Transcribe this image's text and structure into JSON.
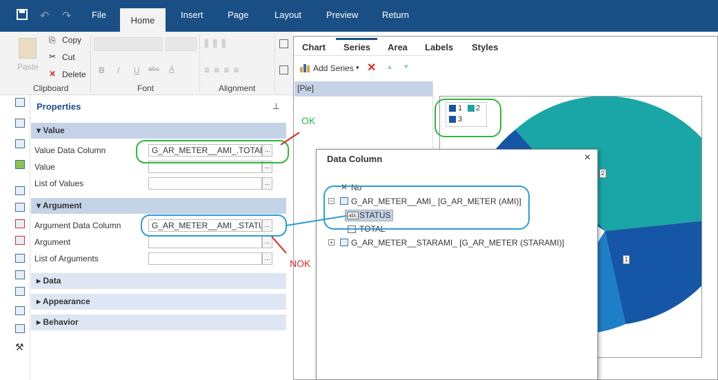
{
  "menu": {
    "file": "File",
    "home": "Home",
    "insert": "Insert",
    "page": "Page",
    "layout": "Layout",
    "preview": "Preview",
    "return": "Return"
  },
  "ribbon": {
    "paste": "Paste",
    "copy": "Copy",
    "cut": "Cut",
    "delete": "Delete",
    "clipboard": "Clipboard",
    "font": "Font",
    "alignment": "Alignment",
    "bold": "B",
    "italic": "I",
    "underline": "U",
    "strike": "abc",
    "fontcolor": "A"
  },
  "properties": {
    "title": "Properties",
    "value_section": "Value",
    "value_data_column_label": "Value Data Column",
    "value_data_column": "G_AR_METER__AMI_.TOTAL",
    "value_label": "Value",
    "list_of_values_label": "List of Values",
    "argument_section": "Argument",
    "argument_data_column_label": "Argument Data Column",
    "argument_data_column": "G_AR_METER__AMI_.STATUS",
    "argument_label": "Argument",
    "list_of_arguments_label": "List of Arguments",
    "data_section": "Data",
    "appearance_section": "Appearance",
    "behavior_section": "Behavior",
    "ellipsis": "..."
  },
  "designer": {
    "tabs": [
      "Chart",
      "Series",
      "Area",
      "Labels",
      "Styles"
    ],
    "add_series": "Add Series",
    "series_item": "[Pie]",
    "legend": [
      "1",
      "2",
      "3"
    ],
    "pie_labels": [
      "2",
      "1"
    ]
  },
  "dialog": {
    "title": "Data Column",
    "close": "×",
    "no_item": "No",
    "source1": "G_AR_METER__AMI_ [G_AR_METER (AMI)]",
    "status": "STATUS",
    "total": "TOTAL",
    "source2": "G_AR_METER__STARAMI_ [G_AR_METER (STARAMI)]",
    "abc_badge": "abc"
  },
  "annotations": {
    "ok": "OK",
    "nok": "NOK"
  },
  "colors": {
    "ribbon_blue": "#1a4f86",
    "pie_teal": "#1aa6a6",
    "pie_blue": "#1557a6",
    "pie_light": "#1e7fc9",
    "ok_green": "#2db63c",
    "nok_red": "#e0281e",
    "highlight_blue": "#2a9bd8"
  }
}
